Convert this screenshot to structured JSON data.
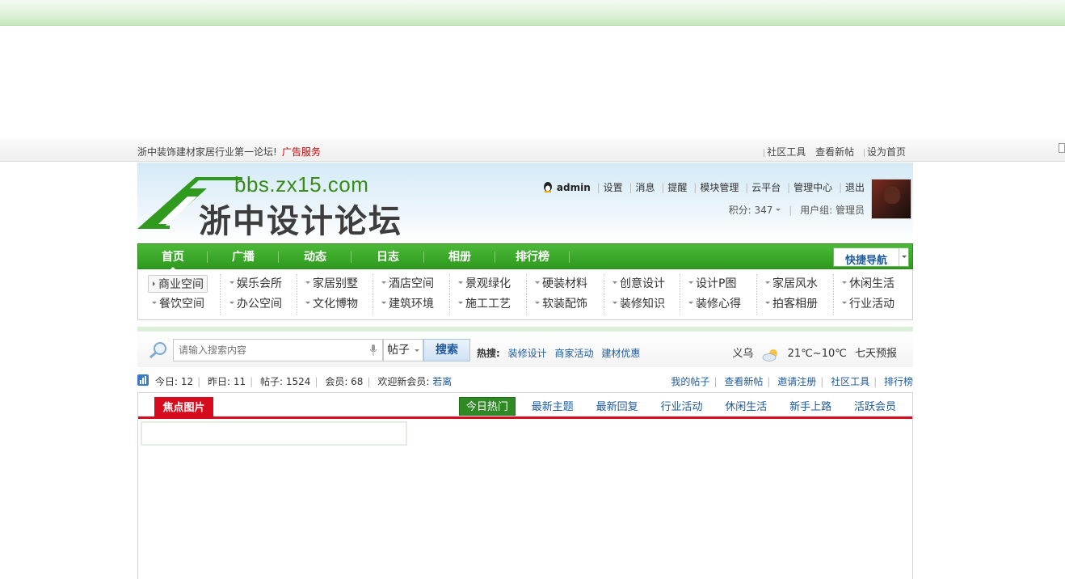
{
  "toolbar": {
    "slogan": "浙中装饰建材家居行业第一论坛!",
    "ad_link": "广告服务",
    "links": [
      "社区工具",
      "查看新帖",
      "设为首页"
    ]
  },
  "header": {
    "logo_url": "bbs.zx15.com",
    "logo_title": "浙中设计论坛",
    "user": {
      "name": "admin",
      "links": [
        "设置",
        "消息",
        "提醒",
        "模块管理",
        "云平台",
        "管理中心",
        "退出"
      ],
      "points_label": "积分: 347",
      "group_label": "用户组: 管理员"
    }
  },
  "nav": {
    "items": [
      "首页",
      "广播",
      "动态",
      "日志",
      "相册",
      "排行榜"
    ],
    "quick_nav": "快捷导航"
  },
  "subnav": {
    "row1": [
      "商业空间",
      "娱乐会所",
      "家居别墅",
      "酒店空间",
      "景观绿化",
      "硬装材料",
      "创意设计",
      "设计P图",
      "家居风水",
      "休闲生活"
    ],
    "row2": [
      "餐饮空间",
      "办公空间",
      "文化博物",
      "建筑环境",
      "施工工艺",
      "软装配饰",
      "装修知识",
      "装修心得",
      "拍客相册",
      "行业活动"
    ]
  },
  "search": {
    "placeholder": "请输入搜索内容",
    "type": "帖子",
    "button": "搜索",
    "hot_label": "热搜:",
    "hot_keywords": [
      "装修设计",
      "商家活动",
      "建材优惠"
    ]
  },
  "weather": {
    "city": "义乌",
    "temp": "21℃~10℃",
    "forecast": "七天预报"
  },
  "stats": {
    "today": "今日: 12",
    "yesterday": "昨日: 11",
    "posts": "帖子: 1524",
    "members": "会员: 68",
    "welcome": "欢迎新会员:",
    "new_member": "若离",
    "links": [
      "我的帖子",
      "查看新帖",
      "邀请注册",
      "社区工具",
      "排行榜"
    ]
  },
  "panel": {
    "focus_tab": "焦点图片",
    "tabs": [
      "今日热门",
      "最新主题",
      "最新回复",
      "行业活动",
      "休闲生活",
      "新手上路",
      "活跃会员"
    ]
  },
  "colors": {
    "nav_green": "#34a023",
    "accent_red": "#d80a1d",
    "link_blue": "#1e5a9a"
  }
}
